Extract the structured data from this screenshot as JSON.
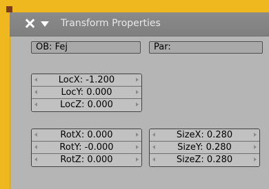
{
  "header": {
    "title": "Transform Properties",
    "close_icon": "close-icon",
    "collapse_icon": "collapse-triangle-icon"
  },
  "fields": {
    "ob": "OB: Fej",
    "par": "Par:"
  },
  "location": [
    {
      "label": "LocX: -1.200"
    },
    {
      "label": "LocY: 0.000"
    },
    {
      "label": "LocZ: 0.000"
    }
  ],
  "rotation": [
    {
      "label": "RotX: 0.000"
    },
    {
      "label": "RotY: -0.000"
    },
    {
      "label": "RotZ: 0.000"
    }
  ],
  "size": [
    {
      "label": "SizeX: 0.280"
    },
    {
      "label": "SizeY: 0.280"
    },
    {
      "label": "SizeZ: 0.280"
    }
  ],
  "colors": {
    "background": "#f0b81f",
    "panel": "#b5b5b5",
    "header": "#858585",
    "button": "#c1c1c1"
  }
}
